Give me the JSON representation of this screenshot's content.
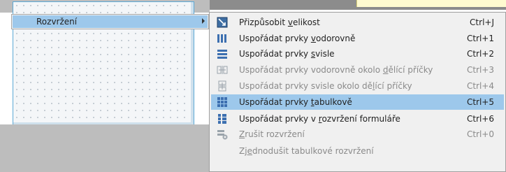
{
  "parent_menu": {
    "label": "Rozvržení"
  },
  "submenu": {
    "items": [
      {
        "pre": "Přizpůsobit ",
        "acc": "v",
        "post": "elikost",
        "shortcut": "Ctrl+J",
        "enabled": true,
        "icon": "adjust-size-icon"
      },
      {
        "pre": "Uspořádat prvky ",
        "acc": "v",
        "post": "odorovně",
        "shortcut": "Ctrl+1",
        "enabled": true,
        "icon": "layout-horizontal-icon"
      },
      {
        "pre": "Uspořádat prvky ",
        "acc": "s",
        "post": "visle",
        "shortcut": "Ctrl+2",
        "enabled": true,
        "icon": "layout-vertical-icon"
      },
      {
        "pre": "Uspořádat prvky vodorovně okolo ",
        "acc": "d",
        "post": "ělící příčky",
        "shortcut": "Ctrl+3",
        "enabled": false,
        "icon": "horizontal-splitter-icon"
      },
      {
        "pre": "Uspořádat prvky svisle okolo dě",
        "acc": "l",
        "post": "ící příčky",
        "shortcut": "Ctrl+4",
        "enabled": false,
        "icon": "vertical-splitter-icon"
      },
      {
        "pre": "Uspořádat prvky ",
        "acc": "t",
        "post": "abulkově",
        "shortcut": "Ctrl+5",
        "enabled": true,
        "highlighted": true,
        "icon": "grid-layout-icon"
      },
      {
        "pre": "Uspořádat prvky v ",
        "acc": "r",
        "post": "ozvržení formuláře",
        "shortcut": "Ctrl+6",
        "enabled": true,
        "icon": "form-layout-icon"
      },
      {
        "pre": "",
        "acc": "Z",
        "post": "rušit rozvržení",
        "shortcut": "Ctrl+0",
        "enabled": false,
        "icon": "break-layout-icon"
      },
      {
        "pre": "Zj",
        "acc": "e",
        "post": "dnodušit tabulkové rozvržení",
        "shortcut": "",
        "enabled": false,
        "icon": ""
      }
    ]
  },
  "colors": {
    "highlight": "#9dc8eb",
    "menu_bg": "#f0f0f0",
    "disabled_text": "#8a8a8a",
    "form_border": "#5da9d6"
  }
}
